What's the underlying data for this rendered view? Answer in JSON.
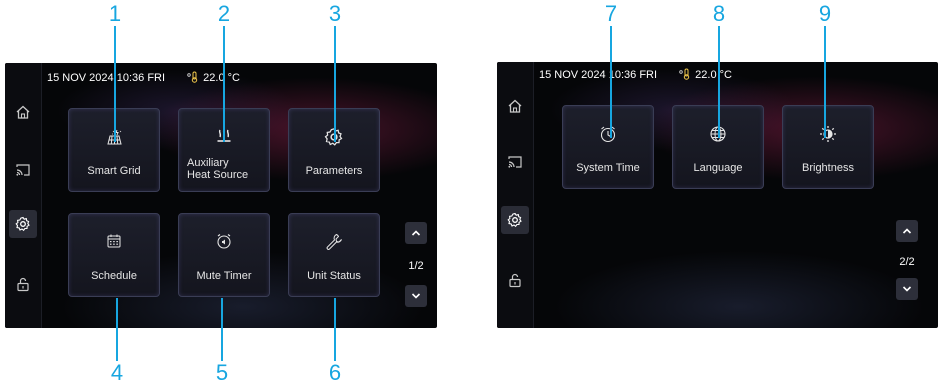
{
  "status": {
    "date": "15 NOV 2024",
    "time": "10:36",
    "day": "FRI",
    "temperature": "22.0 °C"
  },
  "screen1": {
    "tiles": [
      {
        "label": "Smart Grid",
        "icon": "smart-grid-icon"
      },
      {
        "label": "Auxiliary Heat Source",
        "icon": "heat-source-icon"
      },
      {
        "label": "Parameters",
        "icon": "gear-icon"
      },
      {
        "label": "Schedule",
        "icon": "calendar-icon"
      },
      {
        "label": "Mute Timer",
        "icon": "mute-alarm-icon"
      },
      {
        "label": "Unit Status",
        "icon": "wrench-icon"
      }
    ],
    "page": "1/2"
  },
  "screen2": {
    "tiles": [
      {
        "label": "System Time",
        "icon": "clock-icon"
      },
      {
        "label": "Language",
        "icon": "globe-icon"
      },
      {
        "label": "Brightness",
        "icon": "brightness-icon"
      }
    ],
    "page": "2/2"
  },
  "sidebar": {
    "items": [
      "home-icon",
      "cast-icon",
      "settings-icon",
      "unlock-icon"
    ],
    "active": "settings-icon"
  },
  "callouts": [
    "1",
    "2",
    "3",
    "4",
    "5",
    "6",
    "7",
    "8",
    "9"
  ],
  "colors": {
    "callout": "#17a6e0",
    "background": "#050608",
    "tile": "#1d1f2b"
  }
}
